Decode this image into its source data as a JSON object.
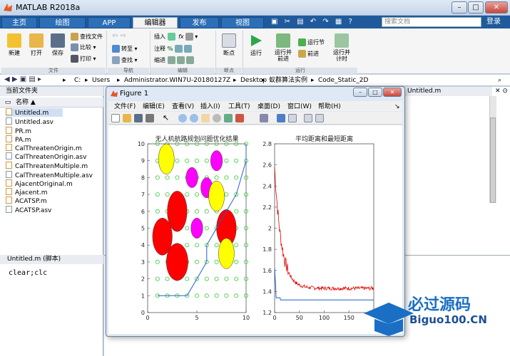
{
  "app": {
    "title": "MATLAB R2018a"
  },
  "tabs": [
    {
      "label": "主页"
    },
    {
      "label": "绘图"
    },
    {
      "label": "APP"
    },
    {
      "label": "编辑器"
    },
    {
      "label": "发布"
    },
    {
      "label": "视图"
    }
  ],
  "search": {
    "placeholder": "搜索文档"
  },
  "login": "登录",
  "ribbon": {
    "file": {
      "new": "新建",
      "open": "打开",
      "save": "保存",
      "find_files": "查找文件",
      "compare": "比较",
      "print": "打印",
      "label": "文件"
    },
    "nav": {
      "goto": "转至",
      "find": "查找",
      "label": "导航"
    },
    "edit": {
      "insert": "插入",
      "comment": "注释",
      "indent": "缩进",
      "label": "编辑"
    },
    "breakpoints": {
      "bp": "断点",
      "label": "断点"
    },
    "run": {
      "run": "运行",
      "run_advance": "运行并\n前进",
      "run_section": "运行节",
      "advance": "前进",
      "run_time": "运行并\n计时",
      "label": "运行"
    }
  },
  "path": [
    "C:",
    "Users",
    "Administrator.WIN7U-20180127Z",
    "Desktop",
    "蚁群算法实例",
    "Code_Static_2D"
  ],
  "current_folder": {
    "header": "当前文件夹",
    "col": "名称",
    "files": [
      "Untitled.m",
      "Untitled.asv",
      "PR.m",
      "PA.m",
      "CalThreatenOrigin.m",
      "CalThreatenOrigin.asv",
      "CalThreatenMultiple.m",
      "CalThreatenMultiple.asv",
      "AjacentOriginal.m",
      "Ajacent.m",
      "ACATSP.m",
      "ACATSP.asv"
    ]
  },
  "details": {
    "title": "Untitled.m  (脚本)"
  },
  "editor_tab": "Untitled.m",
  "command": {
    "text": "clear;clc"
  },
  "figure": {
    "title": "Figure 1",
    "menus": [
      "文件(F)",
      "编辑(E)",
      "查看(V)",
      "插入(I)",
      "工具(T)",
      "桌面(D)",
      "窗口(W)",
      "帮助(H)"
    ]
  },
  "chart_data": [
    {
      "type": "scatter",
      "title": "无人机航路规划问题优化结果",
      "xlim": [
        0,
        10
      ],
      "ylim": [
        0,
        10
      ],
      "xticks": [
        0,
        5,
        10
      ],
      "yticks": [
        0,
        1,
        2,
        3,
        4,
        5,
        6,
        7,
        8,
        9,
        10
      ],
      "grid_points_spacing": 1,
      "threats": [
        {
          "x": 1.9,
          "y": 9.1,
          "rx": 0.8,
          "ry": 0.9,
          "color": "#ffff00"
        },
        {
          "x": 4.5,
          "y": 8.0,
          "rx": 0.6,
          "ry": 0.6,
          "color": "#ff00ff"
        },
        {
          "x": 7.0,
          "y": 9.0,
          "rx": 0.6,
          "ry": 0.6,
          "color": "#ff00ff"
        },
        {
          "x": 6.0,
          "y": 7.4,
          "rx": 0.6,
          "ry": 0.6,
          "color": "#ff00ff"
        },
        {
          "x": 7.0,
          "y": 6.9,
          "rx": 0.8,
          "ry": 0.9,
          "color": "#ffff00"
        },
        {
          "x": 3.0,
          "y": 6.0,
          "rx": 1.0,
          "ry": 1.2,
          "color": "#ff0000"
        },
        {
          "x": 5.0,
          "y": 5.0,
          "rx": 0.6,
          "ry": 0.6,
          "color": "#ff00ff"
        },
        {
          "x": 8.0,
          "y": 5.0,
          "rx": 1.0,
          "ry": 1.1,
          "color": "#ff0000"
        },
        {
          "x": 1.5,
          "y": 4.5,
          "rx": 1.0,
          "ry": 1.1,
          "color": "#ff0000"
        },
        {
          "x": 3.0,
          "y": 3.0,
          "rx": 1.1,
          "ry": 1.1,
          "color": "#ff0000"
        },
        {
          "x": 8.0,
          "y": 3.5,
          "rx": 0.8,
          "ry": 0.9,
          "color": "#ffff00"
        }
      ],
      "path": {
        "x": [
          1,
          4,
          5,
          6,
          6,
          7,
          8,
          9,
          9.5,
          10,
          10
        ],
        "y": [
          1,
          1,
          2,
          3,
          4,
          5,
          6,
          7,
          8,
          9,
          10
        ]
      }
    },
    {
      "type": "line",
      "title": "平均距离和最短距离",
      "xlim": [
        0,
        200
      ],
      "ylim": [
        1.2,
        2.8
      ],
      "xticks": [
        0,
        50,
        100,
        150
      ],
      "yticks": [
        1.2,
        1.4,
        1.6,
        1.8,
        2.0,
        2.2,
        2.4,
        2.6,
        2.8
      ],
      "series": [
        {
          "color": "#e00000"
        },
        {
          "color": "#1f5fd0"
        }
      ]
    }
  ],
  "watermark": {
    "line1": "必过源码",
    "line2": "Biguo100.CN"
  }
}
